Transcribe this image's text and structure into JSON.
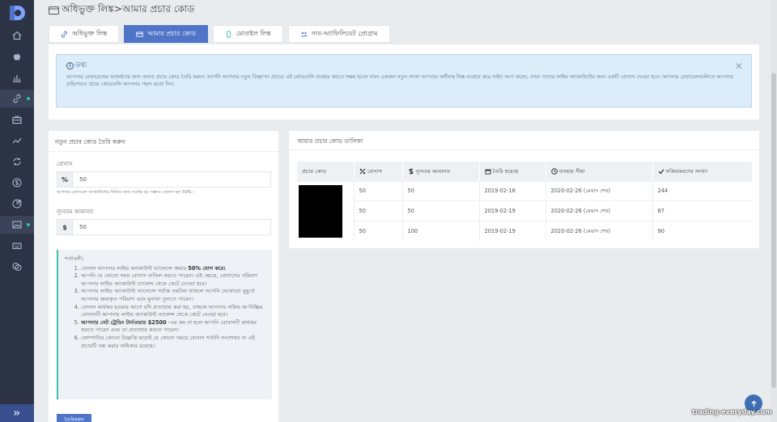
{
  "page_title": "অধিভুক্ত লিঙ্ক>আমার প্রচার কোড",
  "tabs": [
    {
      "label": "অধিভুক্ত লিঙ্ক",
      "icon": "link-icon",
      "active": false
    },
    {
      "label": "আমার প্রচার কোড",
      "icon": "card-icon",
      "active": true
    },
    {
      "label": "মোবাইল লিঙ্ক",
      "icon": "mobile-icon",
      "active": false
    },
    {
      "label": "সাব-অ্যাফিলিয়েট প্রোগ্রাম",
      "icon": "users-icon",
      "active": false
    }
  ],
  "info": {
    "heading": "তথ্য",
    "text": "আপনার রেফারেলের আকর্ষণের জন্য অনন্য প্রচার কোড তৈরি করুন। আপনি আপনার নতুন বিজ্ঞাপন প্রচারে এই কোডগুলি ব্যবহার করতে সক্ষম হবেন যখন একজন নতুন সদস্য আপনার অধীনস্থ লিঙ্ক ব্যবহার করে সাইন আপ করেন, তখন তাদের লাইভ অ্যাকাউন্টের জন্য একটি বোনাস দেওয়া হবে। আপনার রেফারেলগুলিতে আপনার বাছিপারত প্রচার কোডগুলি আপনার পছন্দ হতো দিন।"
  },
  "create": {
    "header": "নতুন প্রচার কোড তৈরি করুন",
    "bonus_label": "বোনাস",
    "bonus_addon": "%",
    "bonus_value": "50",
    "bonus_hint": "আপনার রেফারেল অ্যাকাউন্টের স্থিতির জন্য সর্বোচ্চ হয় সম্ভাব্য বোনাস হল 50% ।",
    "deposit_label": "ন্যূনতম আমানত",
    "deposit_addon": "$",
    "deposit_value": "50",
    "terms_title": "শর্তাবলী:",
    "terms": [
      {
        "text": "বোনাস আপনার লাইভ অ্যাকাউন্ট ব্যালেন্সে জমার ",
        "bold": "50% যোগ করে।",
        "after": ""
      },
      {
        "text": "আপনি যে কোনো সময় বোনাস বাতিল করতে পারেন। এই ক্ষেত্রে, বোনাসের পরিমাণ আপনার লাইভ অ্যাকাউন্ট ব্যালেন্স থেকে কেটে নেওয়া হবে।",
        "bold": "",
        "after": ""
      },
      {
        "text": "আপনার লাইভ অ্যাকাউন্ট ব্যালেন্সে পর্যাপ্ত তহবিল থাকলে আপনি যেকোনো মুহূর্তে আপনার জমাকৃত পরিমাণ এবং মুনাফা তুলতে পারেন।",
        "bold": "",
        "after": ""
      },
      {
        "text": "বোনাস কার্যকর হওয়ার আগে যদি প্রত্যাহার করা হয়, তাহলে আপনার সক্রিয় অ-নিষ্ক্রিয় বোনাসটি আপনার লাইভ অ্যাকাউন্ট ব্যালেন্স থেকে কেটে নেওয়া হবে।",
        "bold": "",
        "after": ""
      },
      {
        "text": "",
        "bold": "আপনার নেট ট্রেডিং টার্নওভার $2500",
        "after": " -এর কম না হলে আপনি বোনাসটি কার্যকর করতে পারেন এবং তা প্রত্যাহার করতে পারেন।"
      },
      {
        "text": "কোম্পানির কোনো বিজ্ঞপ্তি ছাড়াই যে কোনো সময়ে বোনাস শর্তাদি সংশোধন বা এই প্রচারটি বন্ধ করার অধিকার রয়েছে।",
        "bold": "",
        "after": ""
      }
    ],
    "submit_label": "তৈরিকরুন"
  },
  "table": {
    "header": "আমার প্রচার কোড তালিকা",
    "columns": [
      {
        "label": "প্রচার কোড",
        "icon": ""
      },
      {
        "label": "বোনাস",
        "icon": "percent-icon"
      },
      {
        "label": "ন্যূনতম আমানত",
        "icon": "dollar-icon"
      },
      {
        "label": "তৈরি হয়েছে",
        "icon": "calendar-icon"
      },
      {
        "label": "ব্যবহার সীমা",
        "icon": "clock-icon"
      },
      {
        "label": "সক্রিয়করণের সংখ্যা",
        "icon": "check-icon"
      }
    ],
    "rows": [
      {
        "bonus": "50",
        "deposit": "50",
        "created": "2019-02-18",
        "limit": "2020-02-26 (মেয়াদ শেষ)",
        "activations": "244"
      },
      {
        "bonus": "50",
        "deposit": "50",
        "created": "2019-02-19",
        "limit": "2020-02-26 (মেয়াদ শেষ)",
        "activations": "87"
      },
      {
        "bonus": "50",
        "deposit": "100",
        "created": "2019-02-19",
        "limit": "2020-02-26 (মেয়াদ শেষ)",
        "activations": "90"
      }
    ]
  },
  "watermark": "trading-everyday.com",
  "colors": {
    "sidebar": "#2c3345",
    "accent": "#4f74c8",
    "info_bg": "#dcecf8",
    "terms_border": "#3bbfb0"
  }
}
